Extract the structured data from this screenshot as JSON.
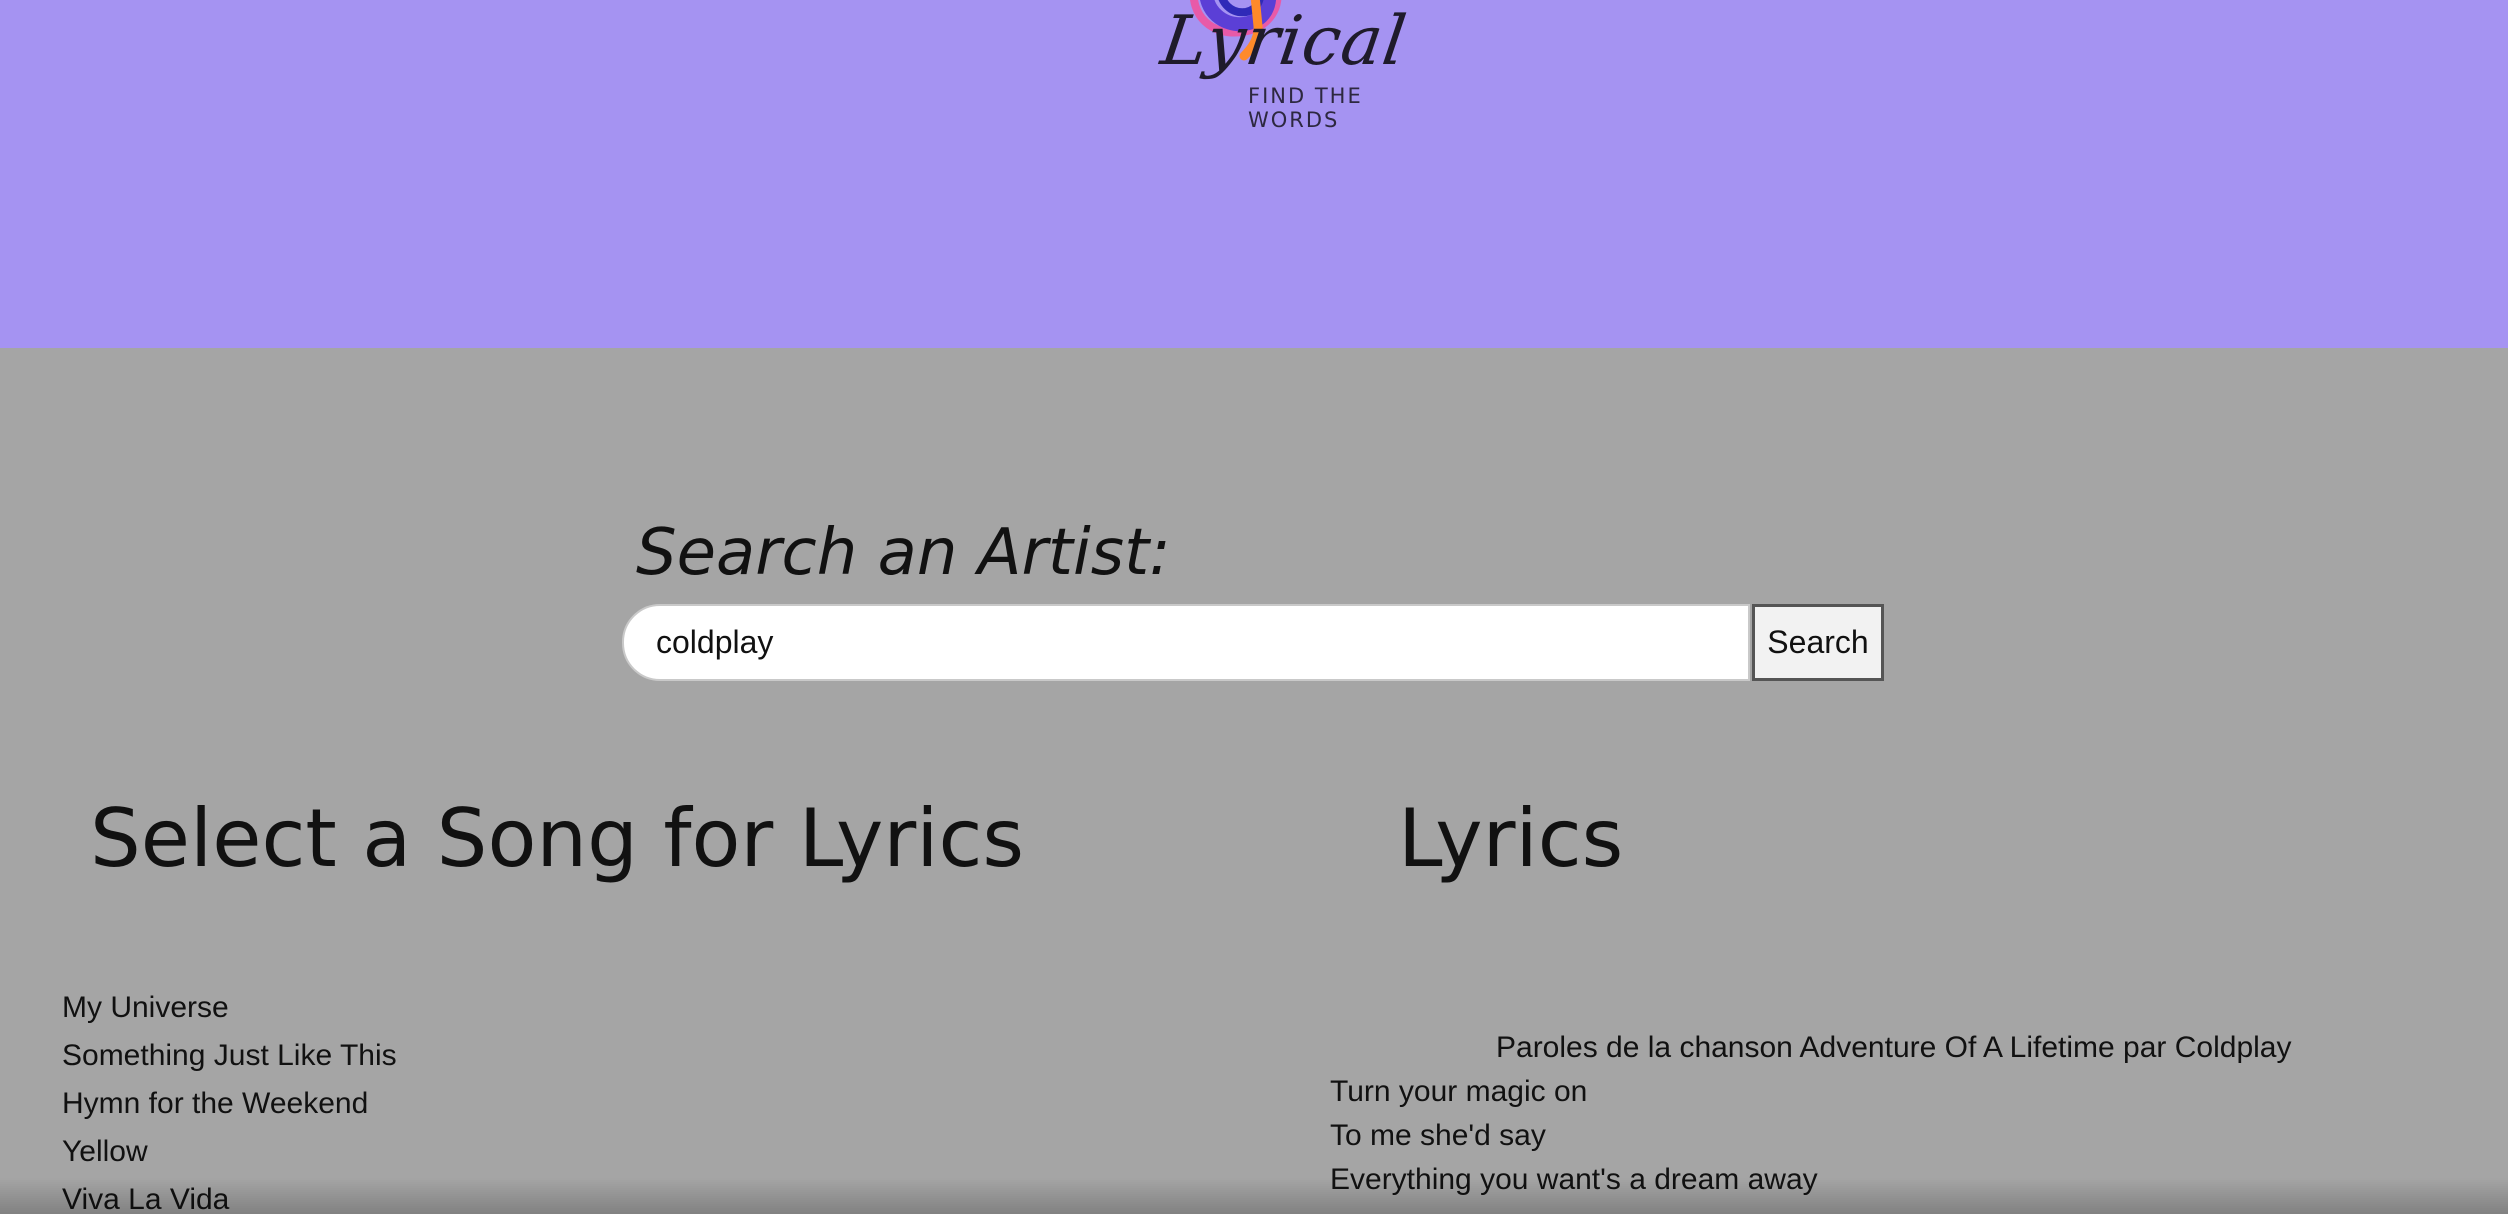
{
  "header": {
    "logo": {
      "wordmark": "Lyrical",
      "tagline": "FIND THE WORDS",
      "icon": "music-swirl-icon",
      "colors": [
        "#5b3fd6",
        "#e85aa8",
        "#ff8a2a"
      ]
    },
    "background": "#a593f2"
  },
  "search": {
    "heading": "Search an Artist:",
    "value": "coldplay",
    "button_label": "Search"
  },
  "songs": {
    "title": "Select a Song for Lyrics",
    "items": [
      "My Universe",
      "Something Just Like This",
      "Hymn for the Weekend",
      "Yellow",
      "Viva La Vida"
    ]
  },
  "lyrics": {
    "title": "Lyrics",
    "header": "Paroles de la chanson Adventure Of A Lifetime par Coldplay",
    "lines": [
      "Turn your magic on",
      "To me she'd say",
      "Everything you want's a dream away"
    ]
  }
}
